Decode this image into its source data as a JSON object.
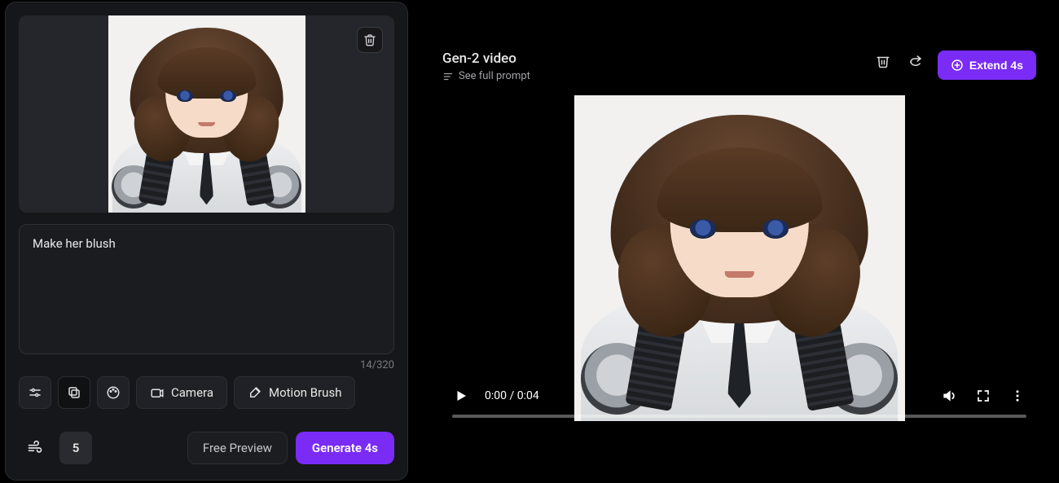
{
  "left": {
    "prompt_value": "Make her blush",
    "char_count": "14/320",
    "tools": {
      "camera_label": "Camera",
      "motion_brush_label": "Motion Brush"
    },
    "motion_value": "5",
    "free_preview_label": "Free Preview",
    "generate_label": "Generate 4s"
  },
  "right": {
    "title": "Gen-2 video",
    "see_prompt_label": "See full prompt",
    "extend_label": "Extend 4s",
    "player": {
      "time": "0:00 / 0:04"
    }
  }
}
